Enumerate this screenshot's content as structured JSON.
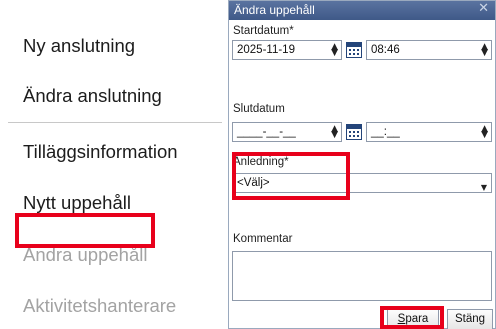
{
  "context_menu": {
    "items": [
      {
        "label": "Ny anslutning",
        "enabled": true
      },
      {
        "label": "Ändra anslutning",
        "enabled": true
      },
      {
        "label": "Tilläggsinformation",
        "enabled": true
      },
      {
        "label": "Nytt uppehåll",
        "enabled": true,
        "highlighted": true
      },
      {
        "label": "Ändra uppehåll",
        "enabled": false
      },
      {
        "label": "Aktivitetshanterare",
        "enabled": false
      }
    ]
  },
  "dialog": {
    "title": "Ändra uppehåll",
    "close_icon": "close-icon",
    "start_label": "Startdatum*",
    "start_date": "2025-11-19",
    "start_time": "08:46",
    "end_label": "Slutdatum",
    "end_date": "____-__-__",
    "end_time": "__:__",
    "reason_label": "Anledning*",
    "reason_value": "<Välj>",
    "comment_label": "Kommentar",
    "comment_value": "",
    "save_label_first": "S",
    "save_label_rest": "para",
    "close_label": "Stäng"
  },
  "colors": {
    "highlight": "#e8001b",
    "titlebar": "#4a6493",
    "disabled_text": "#a3a3a3"
  }
}
